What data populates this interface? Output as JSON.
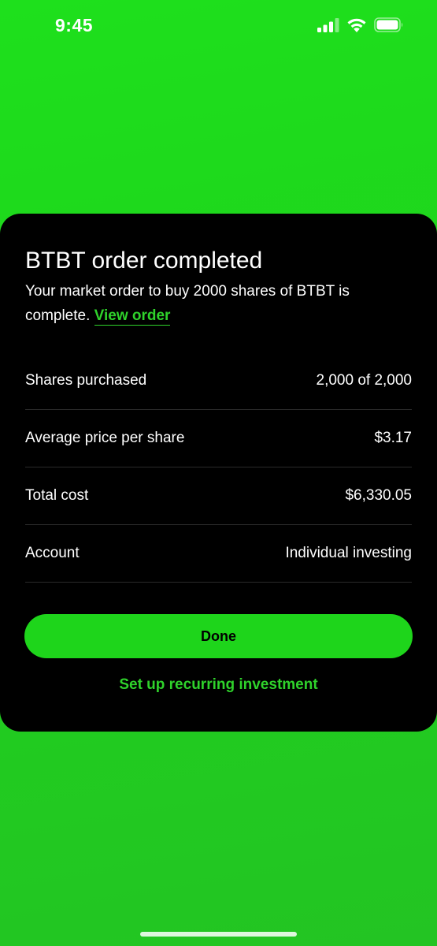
{
  "status_bar": {
    "time": "9:45",
    "icons": [
      "cellular-signal-icon",
      "wifi-icon",
      "battery-icon"
    ]
  },
  "order_sheet": {
    "title": "BTBT order completed",
    "description_prefix": "Your market order to buy 2000 shares of BTBT is complete.",
    "view_order_label": "View order",
    "details": [
      {
        "label": "Shares purchased",
        "value": "2,000 of 2,000"
      },
      {
        "label": "Average price per share",
        "value": "$3.17"
      },
      {
        "label": "Total cost",
        "value": "$6,330.05"
      },
      {
        "label": "Account",
        "value": "Individual investing"
      }
    ],
    "done_label": "Done",
    "recurring_label": "Set up recurring investment"
  },
  "colors": {
    "accent_green": "#1ed51b",
    "link_green": "#2fd22b",
    "sheet_background": "#000000",
    "background_green": "#1fd21d"
  }
}
